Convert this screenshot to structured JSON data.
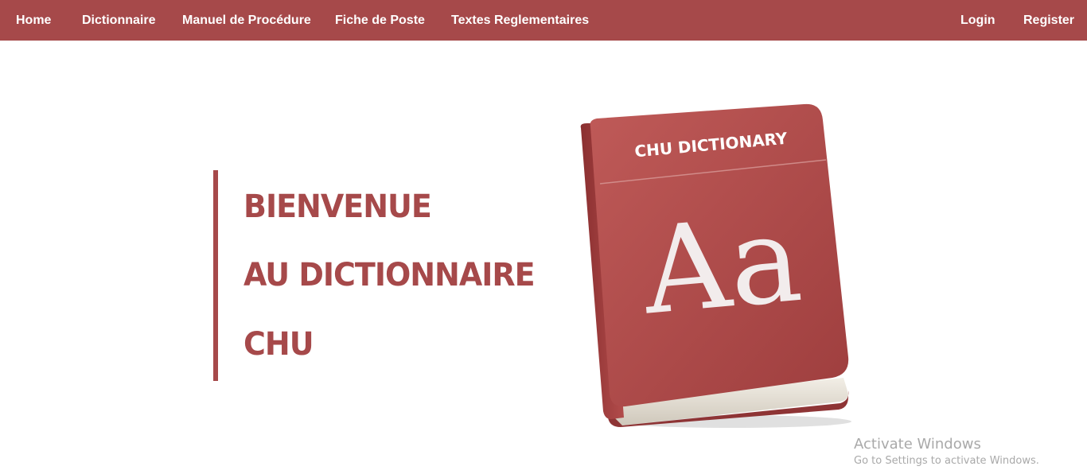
{
  "nav": {
    "left_items": [
      {
        "label": "Home"
      },
      {
        "label": "Dictionnaire"
      },
      {
        "label": "Manuel de Procédure"
      },
      {
        "label": "Fiche de Poste"
      },
      {
        "label": "Textes Reglementaires"
      }
    ],
    "right_items": [
      {
        "label": "Login"
      },
      {
        "label": "Register"
      }
    ]
  },
  "hero": {
    "line1": "BIENVENUE",
    "line2": "AU DICTIONNAIRE",
    "line3": "CHU"
  },
  "book": {
    "title": "CHU DICTIONARY",
    "glyph": "Aa"
  },
  "watermark": {
    "title": "Activate Windows",
    "subtitle": "Go to Settings to activate Windows."
  },
  "colors": {
    "brand": "#a6494a",
    "book_cover": "#b04b4b",
    "text_on_brand": "#ffffff",
    "watermark": "#a9a9a9"
  }
}
